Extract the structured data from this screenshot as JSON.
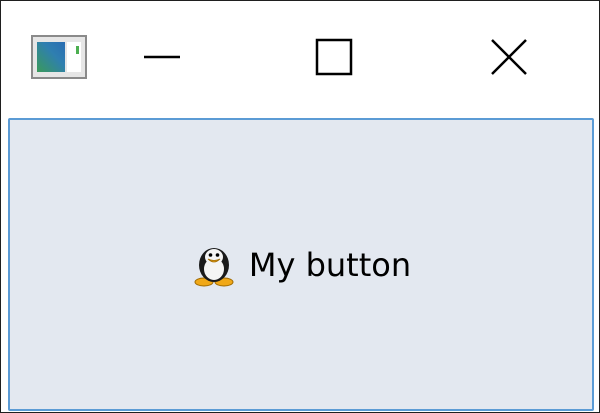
{
  "window": {
    "app_icon": "window-icon",
    "controls": {
      "minimize_icon": "minimize-icon",
      "maximize_icon": "maximize-icon",
      "close_icon": "close-icon"
    }
  },
  "button": {
    "label": "My button",
    "icon": "penguin-icon",
    "background_color": "#e3e8f0",
    "border_color": "#5b9bd5"
  }
}
